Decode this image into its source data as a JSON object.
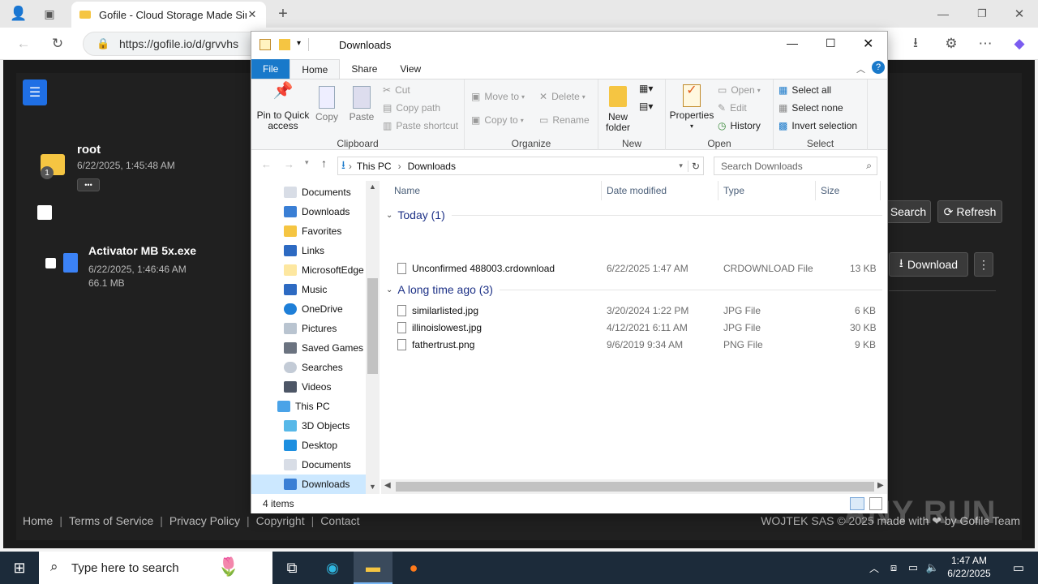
{
  "browser": {
    "tab_title": "Gofile - Cloud Storage Made Simple",
    "url": "https://gofile.io/d/grvvhs"
  },
  "gofile": {
    "folder_name": "root",
    "folder_date": "6/22/2025, 1:45:48 AM",
    "folder_badge": "1",
    "more_label": "•••",
    "file_name": "Activator MB 5x.exe",
    "file_date": "6/22/2025, 1:46:46 AM",
    "file_size": "66.1 MB",
    "search_label": "Search",
    "refresh_label": "Refresh",
    "download_label": "Download",
    "footer": {
      "home": "Home",
      "terms": "Terms of Service",
      "privacy": "Privacy Policy",
      "copyright": "Copyright",
      "contact": "Contact",
      "credit": "WOJTEK SAS © 2025 made with ❤ by Gofile Team"
    }
  },
  "explorer": {
    "title": "Downloads",
    "tabs": [
      "File",
      "Home",
      "Share",
      "View"
    ],
    "ribbon": {
      "pin": "Pin to Quick access",
      "copy": "Copy",
      "paste": "Paste",
      "cut": "Cut",
      "copy_path": "Copy path",
      "paste_shortcut": "Paste shortcut",
      "clipboard": "Clipboard",
      "move_to": "Move to",
      "copy_to": "Copy to",
      "delete": "Delete",
      "rename": "Rename",
      "organize": "Organize",
      "new_folder": "New folder",
      "new": "New",
      "properties": "Properties",
      "open": "Open",
      "edit": "Edit",
      "history": "History",
      "open_group": "Open",
      "select_all": "Select all",
      "select_none": "Select none",
      "invert_selection": "Invert selection",
      "select_group": "Select"
    },
    "path": [
      "This PC",
      "Downloads"
    ],
    "search_placeholder": "Search Downloads",
    "nav_items": [
      {
        "label": "Documents"
      },
      {
        "label": "Downloads"
      },
      {
        "label": "Favorites"
      },
      {
        "label": "Links"
      },
      {
        "label": "MicrosoftEdge"
      },
      {
        "label": "Music"
      },
      {
        "label": "OneDrive"
      },
      {
        "label": "Pictures"
      },
      {
        "label": "Saved Games"
      },
      {
        "label": "Searches"
      },
      {
        "label": "Videos"
      },
      {
        "label": "This PC"
      },
      {
        "label": "3D Objects"
      },
      {
        "label": "Desktop"
      },
      {
        "label": "Documents"
      },
      {
        "label": "Downloads"
      }
    ],
    "columns": [
      "Name",
      "Date modified",
      "Type",
      "Size"
    ],
    "groups": [
      {
        "label": "Today (1)",
        "files": [
          {
            "name": "Unconfirmed 488003.crdownload",
            "date": "6/22/2025 1:47 AM",
            "type": "CRDOWNLOAD File",
            "size": "13 KB"
          }
        ]
      },
      {
        "label": "A long time ago (3)",
        "files": [
          {
            "name": "similarlisted.jpg",
            "date": "3/20/2024 1:22 PM",
            "type": "JPG File",
            "size": "6 KB"
          },
          {
            "name": "illinoislowest.jpg",
            "date": "4/12/2021 6:11 AM",
            "type": "JPG File",
            "size": "30 KB"
          },
          {
            "name": "fathertrust.png",
            "date": "9/6/2019 9:34 AM",
            "type": "PNG File",
            "size": "9 KB"
          }
        ]
      }
    ],
    "status": "4 items"
  },
  "taskbar": {
    "search_placeholder": "Type here to search",
    "time": "1:47 AM",
    "date": "6/22/2025"
  },
  "watermark": "ANY RUN"
}
